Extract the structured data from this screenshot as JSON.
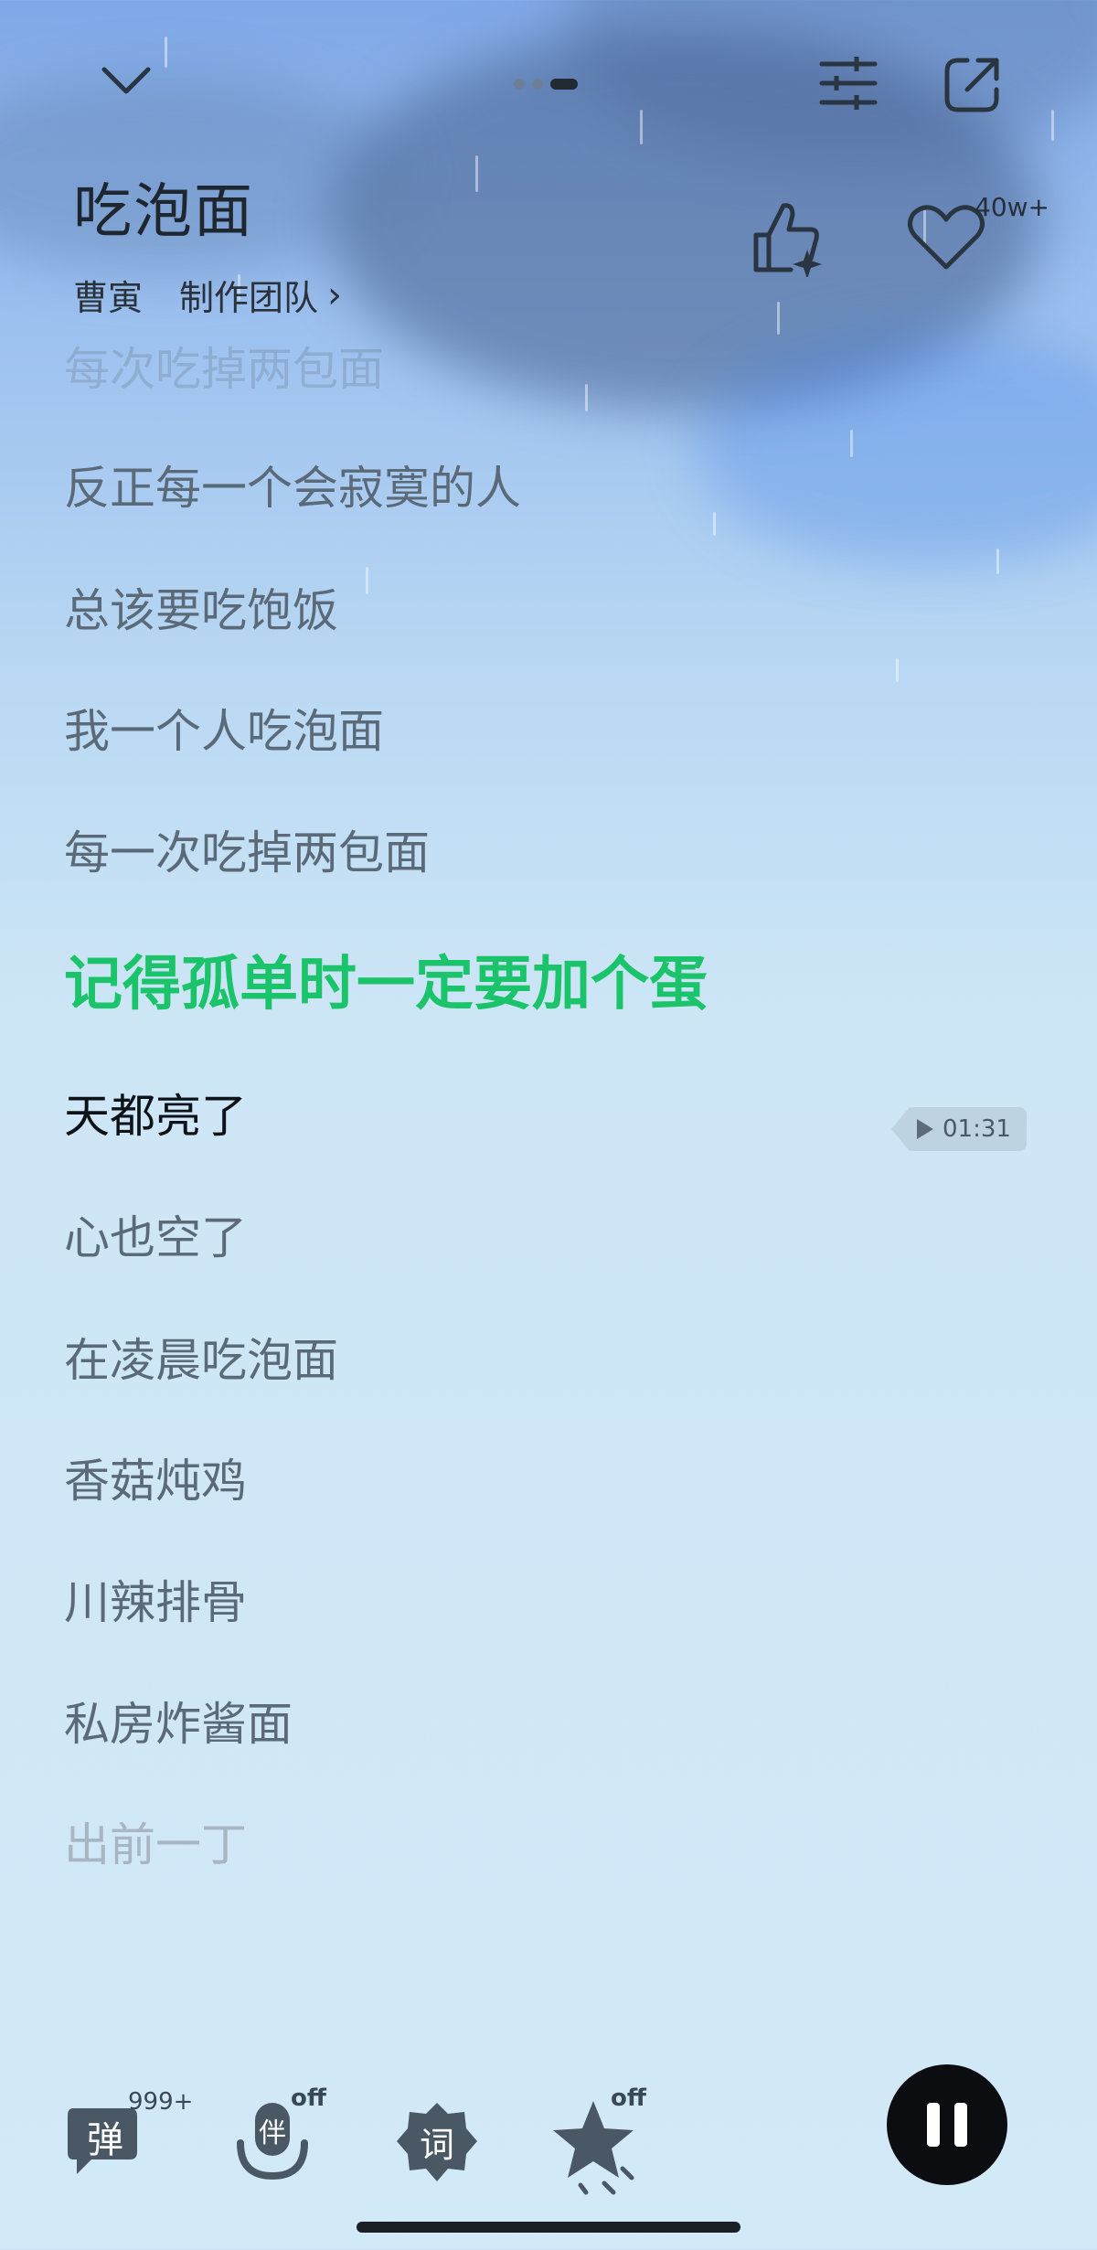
{
  "header": {
    "title": "吃泡面",
    "artist": "曹寅",
    "team_link": "制作团队",
    "like_count": "40w+"
  },
  "lyrics": {
    "partial_top": "每次吃掉两包面",
    "lines_before": [
      "反正每一个会寂寞的人",
      "总该要吃饱饭",
      "我一个人吃泡面",
      "每一次吃掉两包面"
    ],
    "current": "记得孤单时一定要加个蛋",
    "next": "天都亮了",
    "lines_after": [
      "心也空了",
      "在凌晨吃泡面",
      "香菇炖鸡",
      "川辣排骨",
      "私房炸酱面"
    ],
    "faded_last": "出前一丁"
  },
  "seek_chip": {
    "time": "01:31"
  },
  "bottom": {
    "danmaku_label": "弹",
    "danmaku_count": "999+",
    "accompany_label": "伴",
    "accompany_state": "off",
    "lyric_label": "词",
    "effect_state": "off"
  },
  "colors": {
    "accent": "#1bc46a",
    "pause_bg": "#0b0d10"
  }
}
